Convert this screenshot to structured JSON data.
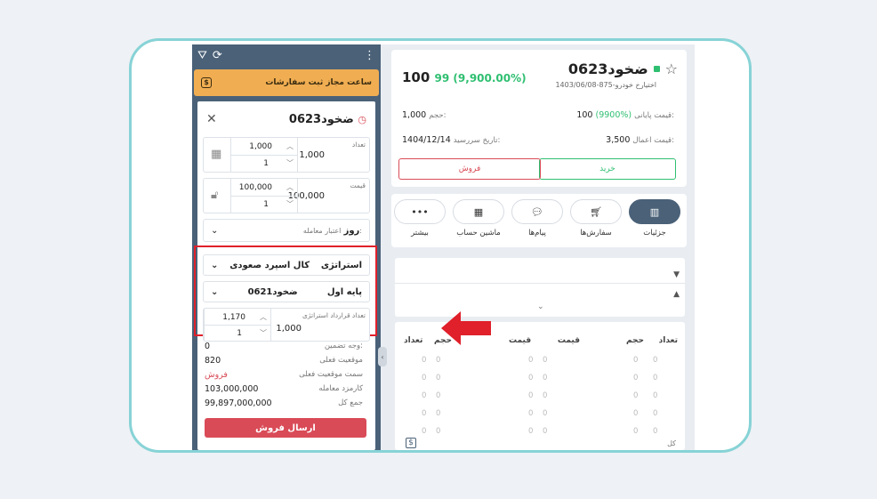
{
  "order_panel": {
    "hours_banner": "ساعت مجاز ثبت سفارشات",
    "symbol": "ضخود0623",
    "quantity": {
      "label": "تعداد",
      "value": "1,000",
      "step_top": "1,000",
      "step_bottom": "1"
    },
    "price": {
      "label": "قیمت",
      "value": "100,000",
      "step_top": "100,000",
      "step_bottom": "1"
    },
    "validity": {
      "label": "اعتبار معامله:",
      "value": "روز"
    },
    "strategy": {
      "label": "استراتژی",
      "value": "کال اسپرد صعودی"
    },
    "base": {
      "label": "پایه اول",
      "value": "ضخود0621"
    },
    "contracts": {
      "label": "تعداد قرارداد استراتژی",
      "value": "1,000",
      "step_top": "1,170",
      "step_bottom": "1"
    },
    "info": [
      {
        "key": "وجه تضمین:",
        "value": "0"
      },
      {
        "key": "موقعیت فعلی",
        "value": "820"
      },
      {
        "key": "سمت موقعیت فعلی",
        "value": "فروش"
      },
      {
        "key": "کارمزد معامله",
        "value": "103,000,000"
      },
      {
        "key": "جمع کل",
        "value": "99,897,000,000"
      }
    ],
    "send_button": "ارسال فروش"
  },
  "instrument": {
    "symbol": "ضخود0623",
    "subtitle": "اختیارخ خودرو-875-1403/06/08",
    "last_price": "100",
    "change": "99 (9,900.00%)",
    "final_price_label": "قیمت پایانی:",
    "final_price": "100",
    "final_pct": "(9900%)",
    "volume_label": "حجم:",
    "volume": "1,000",
    "strike_label": "قیمت اعمال:",
    "strike": "3,500",
    "expiry_label": "تاریخ سررسید:",
    "expiry": "1404/12/14",
    "buy_label": "خرید",
    "sell_label": "فروش"
  },
  "tabs": [
    {
      "label": "جزئیات",
      "icon": "chart-icon"
    },
    {
      "label": "سفارش‌ها",
      "icon": "basket-icon"
    },
    {
      "label": "پیام‌ها",
      "icon": "message-icon"
    },
    {
      "label": "ماشین حساب",
      "icon": "calculator-icon"
    },
    {
      "label": "بیشتر",
      "icon": "more-icon"
    }
  ],
  "depth": {
    "headers_right": [
      "تعداد",
      "حجم",
      "قیمت"
    ],
    "headers_left": [
      "قیمت",
      "حجم",
      "تعداد"
    ],
    "total_label": "کل",
    "zero": "0"
  },
  "colors": {
    "accent": "#4a6178",
    "buy": "#2fbf71",
    "sell": "#d94b57",
    "banner": "#f0ad52",
    "highlight": "#e0202a"
  }
}
